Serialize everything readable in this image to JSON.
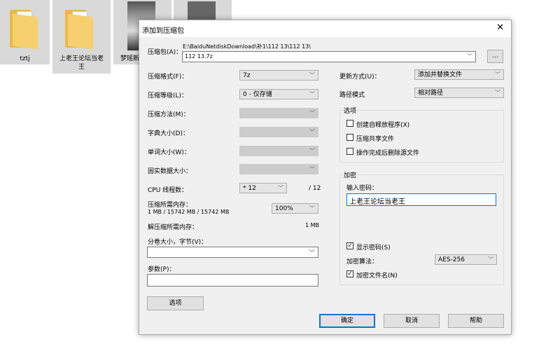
{
  "desktop": {
    "items": [
      {
        "label": "tztj"
      },
      {
        "label": "上老王论坛当老王"
      },
      {
        "label": "梦瑶新"
      },
      {
        "label": ""
      }
    ]
  },
  "dialog": {
    "title": "添加到压缩包",
    "close_icon": "close-icon",
    "archive_label": "压缩包(A)：",
    "archive_path": "E:\\BaiduNetdiskDownload\\补1\\112 13\\112 13\\",
    "archive_name": "112 13.7z",
    "browse_label": "...",
    "format_label": "压缩格式(F)：",
    "format_value": "7z",
    "level_label": "压缩等级(L)：",
    "level_value": "0 - 仅存储",
    "method_label": "压缩方法(M)：",
    "dict_label": "字典大小(D)：",
    "word_label": "单词大小(W)：",
    "solid_label": "固实数据大小：",
    "cpu_label": "CPU 线程数：",
    "cpu_value": "* 12",
    "cpu_total": "/ 12",
    "mem_label": "压缩所需内存：",
    "mem_value": "1 MB / 15742 MB / 15742 MB",
    "mem_pct": "100%",
    "demem_label": "解压缩所需内存：",
    "demem_value": "1 MB",
    "split_label": "分卷大小，字节(V)：",
    "split_value": "",
    "params_label": "参数(P)：",
    "params_value": "",
    "options_button": "选项",
    "update_label": "更新方式(U)：",
    "update_value": "添加并替换文件",
    "path_label": "路径模式",
    "path_value": "相对路径",
    "options_group": "选项",
    "opt_sfx": {
      "label": "创建自释放程序(X)",
      "checked": false
    },
    "opt_shared": {
      "label": "压缩共享文件",
      "checked": false
    },
    "opt_delete": {
      "label": "操作完成后删除源文件",
      "checked": false
    },
    "enc_group": "加密",
    "password_label": "输入密码：",
    "password_value": "上老王论坛当老王",
    "show_pw": {
      "label": "显示密码(S)",
      "checked": true
    },
    "enc_method_label": "加密算法：",
    "enc_method_value": "AES-256",
    "enc_names": {
      "label": "加密文件名(N)",
      "checked": true
    },
    "ok": "确定",
    "cancel": "取消",
    "help": "帮助"
  }
}
